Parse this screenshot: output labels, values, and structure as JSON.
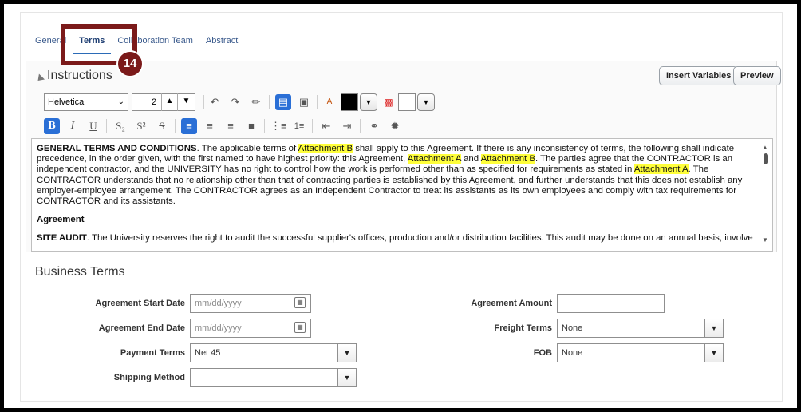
{
  "tabs": [
    {
      "label": "General"
    },
    {
      "label": "Terms"
    },
    {
      "label": "Collaboration Team"
    },
    {
      "label": "Abstract"
    }
  ],
  "callout": {
    "number": "14"
  },
  "instructions": {
    "title": "Instructions",
    "insert_variables_label": "Insert Variables",
    "preview_label": "Preview",
    "font_family": "Helvetica",
    "font_size": "2",
    "text_color": "#000000",
    "background_color": "#ffffff"
  },
  "editor": {
    "p1_title": "GENERAL TERMS AND CONDITIONS",
    "p1_a": ".  The applicable terms of ",
    "p1_hl1": "Attachment B",
    "p1_b": " shall apply to this Agreement. If there is any inconsistency of terms, the following shall indicate precedence, in the order given, with the first named to have highest priority: this Agreement, ",
    "p1_hl2": "Attachment A",
    "p1_c": " and ",
    "p1_hl3": "Attachment B",
    "p1_d": ".  The parties agree that the CONTRACTOR is an independent contractor, and the UNIVERSITY has no right to control how the work is performed other than as specified for requirements as stated in ",
    "p1_hl4": "Attachment A",
    "p1_e": ".   The CONTRACTOR understands that no relationship other than that of contracting parties is established by this Agreement, and further understands that this does not establish any employer-employee arrangement.  The CONTRACTOR agrees as an Independent Contractor to treat its assistants as its own employees and comply with tax requirements for CONTRACTOR and its assistants.",
    "p2_title": "Agreement",
    "p3_title": "SITE AUDIT",
    "p3_text": ".  The University reserves the right to audit the successful supplier's offices, production and/or distribution facilities.  This audit may be done on an annual basis, involve"
  },
  "business_terms": {
    "title": "Business Terms",
    "agreement_start_date": {
      "label": "Agreement Start Date",
      "placeholder": "mm/dd/yyyy"
    },
    "agreement_end_date": {
      "label": "Agreement End Date",
      "placeholder": "mm/dd/yyyy"
    },
    "payment_terms": {
      "label": "Payment Terms",
      "value": "Net 45"
    },
    "shipping_method": {
      "label": "Shipping Method",
      "value": ""
    },
    "agreement_amount": {
      "label": "Agreement Amount",
      "value": ""
    },
    "freight_terms": {
      "label": "Freight Terms",
      "value": "None"
    },
    "fob": {
      "label": "FOB",
      "value": "None"
    }
  },
  "colors": {
    "accent": "#2a6fd6",
    "callout": "#7b1a1a",
    "highlight": "#ffff3a"
  }
}
